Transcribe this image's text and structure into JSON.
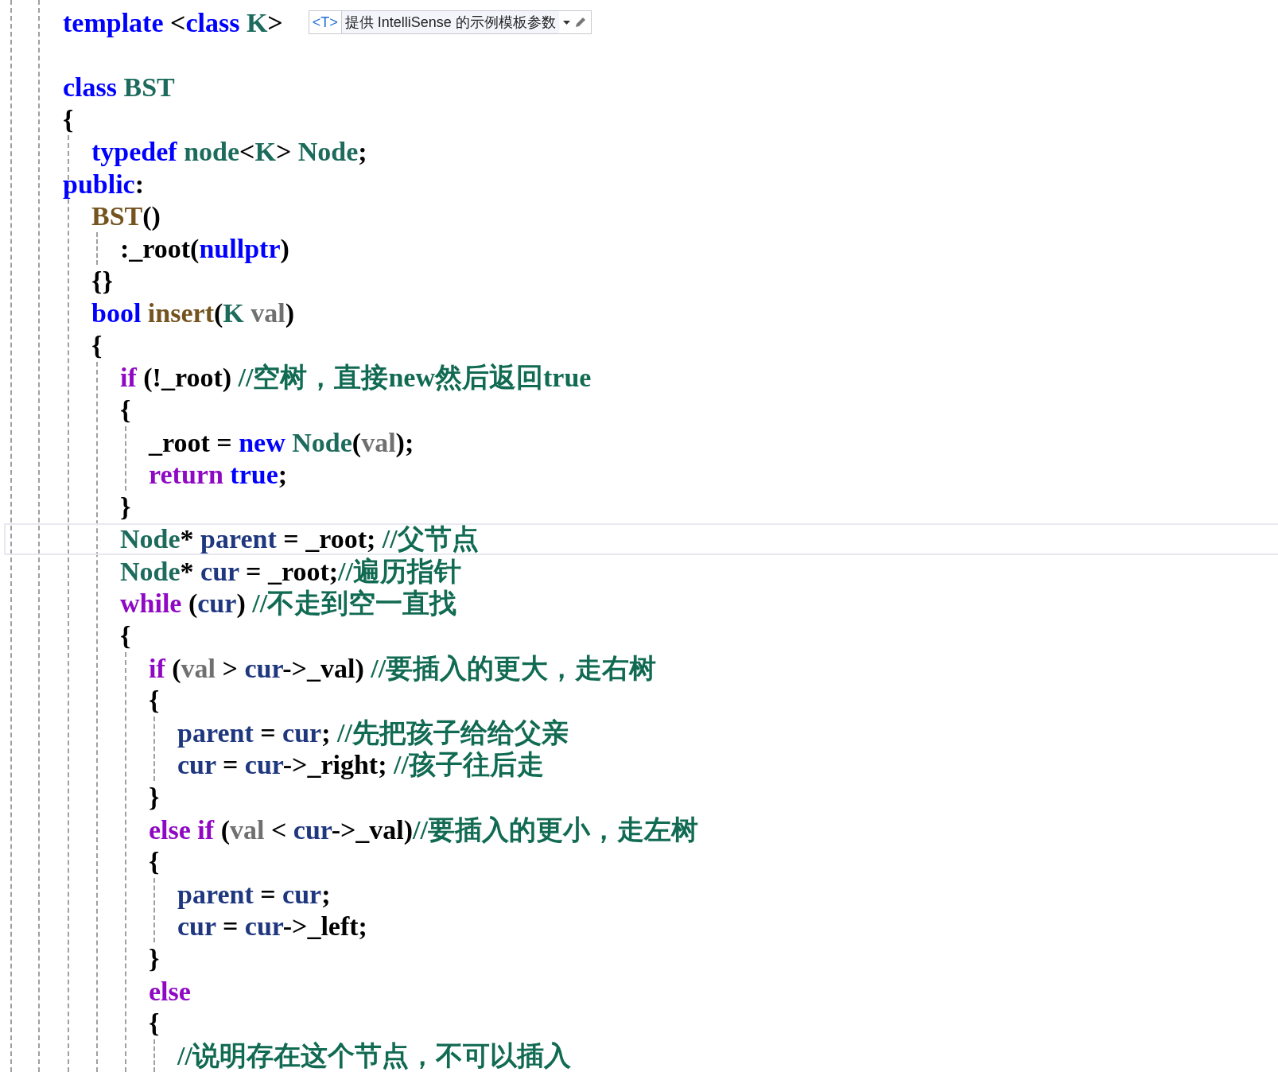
{
  "editor": {
    "lines": [
      {
        "kind": "code",
        "current": false,
        "tokens": [
          {
            "kind": "keyword",
            "text": "template"
          },
          {
            "kind": "plain",
            "text": " <"
          },
          {
            "kind": "keyword",
            "text": "class "
          },
          {
            "kind": "type",
            "text": "K"
          },
          {
            "kind": "plain",
            "text": ">"
          }
        ],
        "popup": {
          "tag": "<T>",
          "text": "提供 IntelliSense 的示例模板参数"
        }
      },
      {
        "kind": "blank",
        "current": false
      },
      {
        "kind": "code",
        "current": false,
        "tokens": [
          {
            "kind": "keyword",
            "text": "class "
          },
          {
            "kind": "type",
            "text": "BST"
          }
        ]
      },
      {
        "kind": "code",
        "current": false,
        "tokens": [
          {
            "kind": "plain",
            "text": "{"
          }
        ],
        "children": [
          {
            "kind": "code",
            "current": false,
            "tokens": [
              {
                "kind": "keyword",
                "text": "typedef "
              },
              {
                "kind": "type",
                "text": "node"
              },
              {
                "kind": "plain",
                "text": "<"
              },
              {
                "kind": "type",
                "text": "K"
              },
              {
                "kind": "plain",
                "text": "> "
              },
              {
                "kind": "type",
                "text": "Node"
              },
              {
                "kind": "plain",
                "text": ";"
              }
            ]
          },
          {
            "kind": "label",
            "current": false,
            "tokens": [
              {
                "kind": "keyword",
                "text": "public"
              },
              {
                "kind": "plain",
                "text": ":"
              }
            ]
          },
          {
            "kind": "code",
            "current": false,
            "tokens": [
              {
                "kind": "function",
                "text": "BST"
              },
              {
                "kind": "plain",
                "text": "()"
              }
            ],
            "children": [
              {
                "kind": "code",
                "current": false,
                "tokens": [
                  {
                    "kind": "plain",
                    "text": ":_root("
                  },
                  {
                    "kind": "keyword",
                    "text": "nullptr"
                  },
                  {
                    "kind": "plain",
                    "text": ")"
                  }
                ]
              }
            ]
          },
          {
            "kind": "code",
            "current": false,
            "tokens": [
              {
                "kind": "plain",
                "text": "{}"
              }
            ]
          },
          {
            "kind": "code",
            "current": false,
            "tokens": [
              {
                "kind": "keyword",
                "text": "bool "
              },
              {
                "kind": "function",
                "text": "insert"
              },
              {
                "kind": "plain",
                "text": "("
              },
              {
                "kind": "type",
                "text": "K "
              },
              {
                "kind": "param",
                "text": "val"
              },
              {
                "kind": "plain",
                "text": ")"
              }
            ]
          },
          {
            "kind": "code",
            "current": false,
            "tokens": [
              {
                "kind": "plain",
                "text": "{"
              }
            ],
            "children": [
              {
                "kind": "code",
                "current": false,
                "tokens": [
                  {
                    "kind": "control",
                    "text": "if"
                  },
                  {
                    "kind": "plain",
                    "text": " (!_root) "
                  },
                  {
                    "kind": "comment",
                    "text": "//空树，直接new然后返回true"
                  }
                ]
              },
              {
                "kind": "code",
                "current": false,
                "tokens": [
                  {
                    "kind": "plain",
                    "text": "{"
                  }
                ],
                "children": [
                  {
                    "kind": "code",
                    "current": false,
                    "tokens": [
                      {
                        "kind": "plain",
                        "text": "_root = "
                      },
                      {
                        "kind": "keyword",
                        "text": "new "
                      },
                      {
                        "kind": "type",
                        "text": "Node"
                      },
                      {
                        "kind": "plain",
                        "text": "("
                      },
                      {
                        "kind": "param",
                        "text": "val"
                      },
                      {
                        "kind": "plain",
                        "text": ");"
                      }
                    ]
                  },
                  {
                    "kind": "code",
                    "current": false,
                    "tokens": [
                      {
                        "kind": "control",
                        "text": "return "
                      },
                      {
                        "kind": "keyword",
                        "text": "true"
                      },
                      {
                        "kind": "plain",
                        "text": ";"
                      }
                    ]
                  }
                ]
              },
              {
                "kind": "code",
                "current": false,
                "tokens": [
                  {
                    "kind": "plain",
                    "text": "}"
                  }
                ]
              },
              {
                "kind": "code",
                "current": true,
                "tokens": [
                  {
                    "kind": "type",
                    "text": "Node"
                  },
                  {
                    "kind": "plain",
                    "text": "* "
                  },
                  {
                    "kind": "local",
                    "text": "parent"
                  },
                  {
                    "kind": "plain",
                    "text": " = _root; "
                  },
                  {
                    "kind": "comment",
                    "text": "//父节点"
                  }
                ]
              },
              {
                "kind": "code",
                "current": false,
                "tokens": [
                  {
                    "kind": "type",
                    "text": "Node"
                  },
                  {
                    "kind": "plain",
                    "text": "* "
                  },
                  {
                    "kind": "local",
                    "text": "cur"
                  },
                  {
                    "kind": "plain",
                    "text": " = _root;"
                  },
                  {
                    "kind": "comment",
                    "text": "//遍历指针"
                  }
                ]
              },
              {
                "kind": "code",
                "current": false,
                "tokens": [
                  {
                    "kind": "control",
                    "text": "while"
                  },
                  {
                    "kind": "plain",
                    "text": " ("
                  },
                  {
                    "kind": "local",
                    "text": "cur"
                  },
                  {
                    "kind": "plain",
                    "text": ") "
                  },
                  {
                    "kind": "comment",
                    "text": "//不走到空一直找"
                  }
                ]
              },
              {
                "kind": "code",
                "current": false,
                "tokens": [
                  {
                    "kind": "plain",
                    "text": "{"
                  }
                ],
                "children": [
                  {
                    "kind": "code",
                    "current": false,
                    "tokens": [
                      {
                        "kind": "control",
                        "text": "if"
                      },
                      {
                        "kind": "plain",
                        "text": " ("
                      },
                      {
                        "kind": "param",
                        "text": "val"
                      },
                      {
                        "kind": "plain",
                        "text": " > "
                      },
                      {
                        "kind": "local",
                        "text": "cur"
                      },
                      {
                        "kind": "plain",
                        "text": "->_val) "
                      },
                      {
                        "kind": "comment",
                        "text": "//要插入的更大，走右树"
                      }
                    ]
                  },
                  {
                    "kind": "code",
                    "current": false,
                    "tokens": [
                      {
                        "kind": "plain",
                        "text": "{"
                      }
                    ],
                    "children": [
                      {
                        "kind": "code",
                        "current": false,
                        "tokens": [
                          {
                            "kind": "local",
                            "text": "parent"
                          },
                          {
                            "kind": "plain",
                            "text": " = "
                          },
                          {
                            "kind": "local",
                            "text": "cur"
                          },
                          {
                            "kind": "plain",
                            "text": "; "
                          },
                          {
                            "kind": "comment",
                            "text": "//先把孩子给给父亲"
                          }
                        ]
                      },
                      {
                        "kind": "code",
                        "current": false,
                        "tokens": [
                          {
                            "kind": "local",
                            "text": "cur"
                          },
                          {
                            "kind": "plain",
                            "text": " = "
                          },
                          {
                            "kind": "local",
                            "text": "cur"
                          },
                          {
                            "kind": "plain",
                            "text": "->_right; "
                          },
                          {
                            "kind": "comment",
                            "text": "//孩子往后走"
                          }
                        ]
                      }
                    ]
                  },
                  {
                    "kind": "code",
                    "current": false,
                    "tokens": [
                      {
                        "kind": "plain",
                        "text": "}"
                      }
                    ]
                  },
                  {
                    "kind": "code",
                    "current": false,
                    "tokens": [
                      {
                        "kind": "control",
                        "text": "else if"
                      },
                      {
                        "kind": "plain",
                        "text": " ("
                      },
                      {
                        "kind": "param",
                        "text": "val"
                      },
                      {
                        "kind": "plain",
                        "text": " < "
                      },
                      {
                        "kind": "local",
                        "text": "cur"
                      },
                      {
                        "kind": "plain",
                        "text": "->_val)"
                      },
                      {
                        "kind": "comment",
                        "text": "//要插入的更小，走左树"
                      }
                    ]
                  },
                  {
                    "kind": "code",
                    "current": false,
                    "tokens": [
                      {
                        "kind": "plain",
                        "text": "{"
                      }
                    ],
                    "children": [
                      {
                        "kind": "code",
                        "current": false,
                        "tokens": [
                          {
                            "kind": "local",
                            "text": "parent"
                          },
                          {
                            "kind": "plain",
                            "text": " = "
                          },
                          {
                            "kind": "local",
                            "text": "cur"
                          },
                          {
                            "kind": "plain",
                            "text": ";"
                          }
                        ]
                      },
                      {
                        "kind": "code",
                        "current": false,
                        "tokens": [
                          {
                            "kind": "local",
                            "text": "cur"
                          },
                          {
                            "kind": "plain",
                            "text": " = "
                          },
                          {
                            "kind": "local",
                            "text": "cur"
                          },
                          {
                            "kind": "plain",
                            "text": "->_left;"
                          }
                        ]
                      }
                    ]
                  },
                  {
                    "kind": "code",
                    "current": false,
                    "tokens": [
                      {
                        "kind": "plain",
                        "text": "}"
                      }
                    ]
                  },
                  {
                    "kind": "code",
                    "current": false,
                    "tokens": [
                      {
                        "kind": "control",
                        "text": "else"
                      }
                    ]
                  },
                  {
                    "kind": "code",
                    "current": false,
                    "tokens": [
                      {
                        "kind": "plain",
                        "text": "{"
                      }
                    ],
                    "children": [
                      {
                        "kind": "code",
                        "current": false,
                        "tokens": [
                          {
                            "kind": "comment",
                            "text": "//说明存在这个节点，不可以插入"
                          }
                        ]
                      }
                    ]
                  }
                ]
              }
            ]
          }
        ]
      }
    ]
  }
}
